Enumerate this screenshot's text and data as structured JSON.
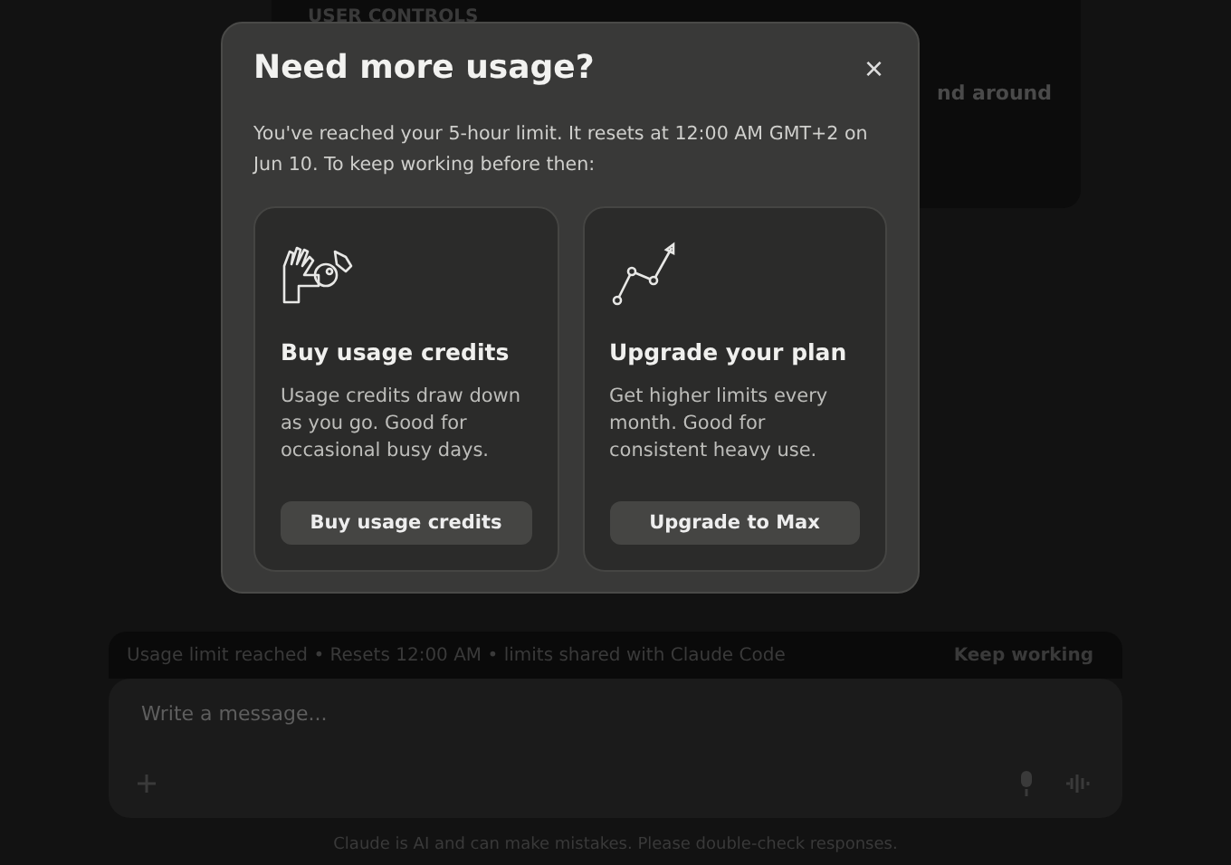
{
  "background": {
    "message_card": {
      "heading": "USER CONTROLS",
      "fragment": "nd around"
    },
    "limit_banner": {
      "text": "Usage limit reached • Resets 12:00 AM • limits shared with Claude Code",
      "action": "Keep working"
    },
    "composer": {
      "placeholder": "Write a message..."
    },
    "disclaimer": "Claude is AI and can make mistakes. Please double-check responses."
  },
  "dialog": {
    "title": "Need more usage?",
    "close": "×",
    "message": "You've reached your 5-hour limit. It resets at 12:00 AM GMT+2 on Jun 10. To keep working before then:",
    "options": [
      {
        "kind": "credits",
        "title": "Buy usage credits",
        "description": "Usage credits draw down as you go. Good for occasional busy days.",
        "button": "Buy usage credits"
      },
      {
        "kind": "upgrade",
        "title": "Upgrade your plan",
        "description": "Get higher limits every month. Good for consistent heavy use.",
        "button": "Upgrade to Max"
      }
    ]
  }
}
